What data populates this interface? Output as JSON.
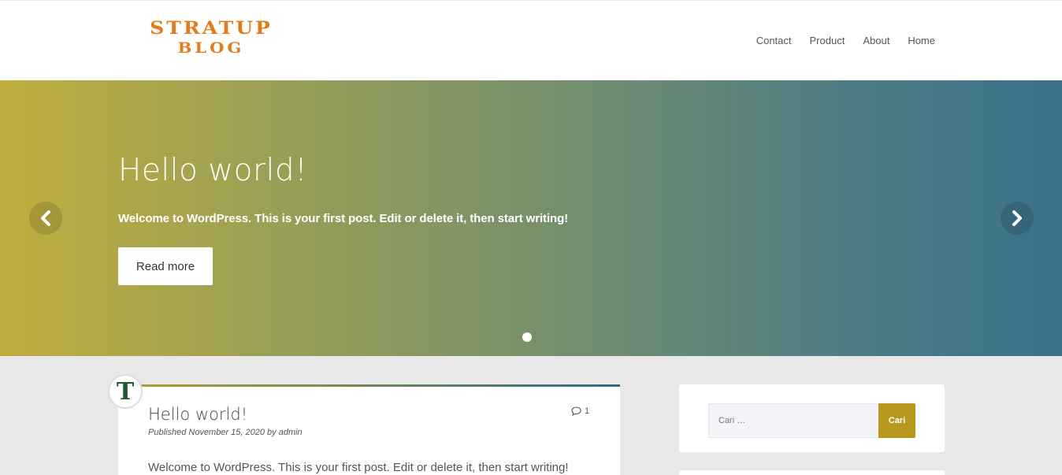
{
  "site": {
    "logo_line1": "STRATUP",
    "logo_line2": "BLOG"
  },
  "nav": {
    "items": [
      {
        "label": "Contact"
      },
      {
        "label": "Product"
      },
      {
        "label": "About"
      },
      {
        "label": "Home"
      }
    ]
  },
  "hero": {
    "title": "Hello world!",
    "text": "Welcome to WordPress. This is your first post. Edit or delete it, then start writing!",
    "button_label": "Read more",
    "prev_icon": "chevron-left-icon",
    "next_icon": "chevron-right-icon",
    "slide_count": 1,
    "active_slide": 1
  },
  "post": {
    "avatar_letter": "T",
    "title": "Hello world!",
    "meta": "Published November 15, 2020 by admin",
    "comment_count": "1",
    "comment_icon": "comment-icon",
    "excerpt": "Welcome to WordPress. This is your first post. Edit or delete it, then start writing!"
  },
  "search": {
    "placeholder": "Cari …",
    "button_label": "Cari"
  },
  "colors": {
    "logo": "#e47a1a",
    "hero_gradient_start": "#bfae3e",
    "hero_gradient_end": "#3a728c",
    "search_button": "#b7991f",
    "avatar_letter": "#1f5b2e"
  }
}
